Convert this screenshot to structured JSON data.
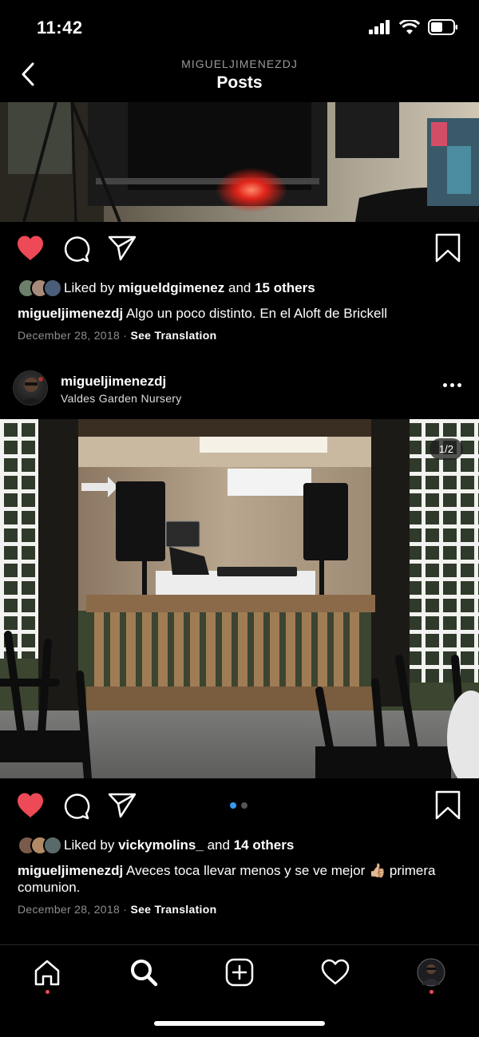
{
  "status_bar": {
    "time": "11:42"
  },
  "header": {
    "username": "MIGUELJIMENEZDJ",
    "title": "Posts"
  },
  "colors": {
    "like_red": "#ed4956",
    "accent_blue": "#3897f0",
    "muted": "#8e8e8e"
  },
  "posts": [
    {
      "likes": {
        "prefix": "Liked by",
        "user": "migueldgimenez",
        "and": "and",
        "others": "15 others"
      },
      "caption": {
        "user": "migueljimenezdj",
        "text": "Algo un poco distinto. En el Aloft de Brickell"
      },
      "date": "December 28, 2018",
      "separator": "·",
      "translate": "See Translation",
      "liked": true
    },
    {
      "author": {
        "username": "migueljimenezdj",
        "location": "Valdes Garden Nursery"
      },
      "counter": "1/2",
      "carousel": {
        "count": 2,
        "active": 1
      },
      "likes": {
        "prefix": "Liked by",
        "user": "vickymolins_",
        "and": "and",
        "others": "14 others"
      },
      "caption": {
        "user": "migueljimenezdj",
        "text": "Aveces toca llevar menos y se ve mejor 👍🏼 primera comunion."
      },
      "date": "December 28, 2018",
      "separator": "·",
      "translate": "See Translation",
      "liked": true
    }
  ],
  "tabbar": {
    "icons": [
      "home-icon",
      "search-icon",
      "new-post-icon",
      "activity-icon",
      "profile-avatar"
    ]
  }
}
